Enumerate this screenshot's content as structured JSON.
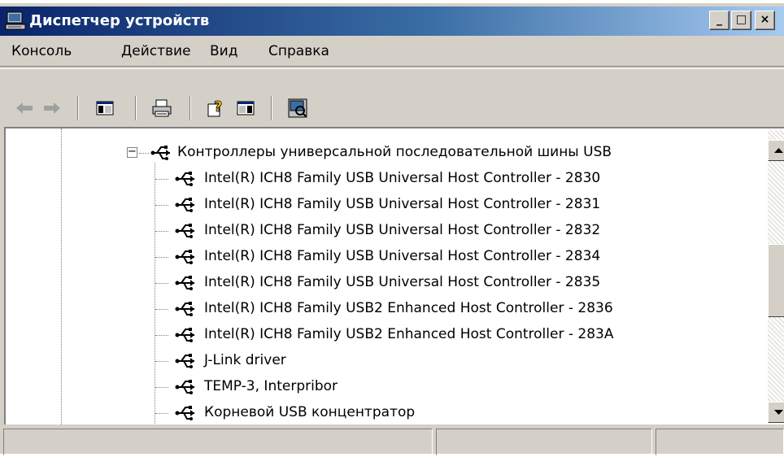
{
  "window": {
    "title": "Диспетчер устройств",
    "controls": {
      "minimize": "_",
      "maximize": "□",
      "close": "×"
    }
  },
  "menu": {
    "items": [
      "Консоль",
      "Действие",
      "Вид",
      "Справка"
    ]
  },
  "toolbar": {
    "buttons": [
      {
        "icon": "back-arrow-icon"
      },
      {
        "icon": "forward-arrow-icon"
      },
      {
        "icon": "show-hide-console-tree-icon"
      },
      {
        "icon": "print-icon"
      },
      {
        "icon": "help-icon"
      },
      {
        "icon": "properties-icon"
      },
      {
        "icon": "scan-hardware-icon"
      }
    ]
  },
  "tree": {
    "category": {
      "label": "Контроллеры универсальной последовательной шины USB",
      "expander": "−",
      "icon": "usb-icon"
    },
    "items": [
      "Intel(R) ICH8 Family USB Universal Host Controller - 2830",
      "Intel(R) ICH8 Family USB Universal Host Controller - 2831",
      "Intel(R) ICH8 Family USB Universal Host Controller - 2832",
      "Intel(R) ICH8 Family USB Universal Host Controller - 2834",
      "Intel(R) ICH8 Family USB Universal Host Controller - 2835",
      "Intel(R) ICH8 Family USB2 Enhanced Host Controller - 2836",
      "Intel(R) ICH8 Family USB2 Enhanced Host Controller - 283A",
      "J-Link driver",
      "TEMP-3, Interpribor",
      "Корневой USB концентратор"
    ]
  },
  "colors": {
    "title_gradient_start": "#0a246a",
    "title_gradient_end": "#a6caf0",
    "face": "#d4d0c8"
  }
}
